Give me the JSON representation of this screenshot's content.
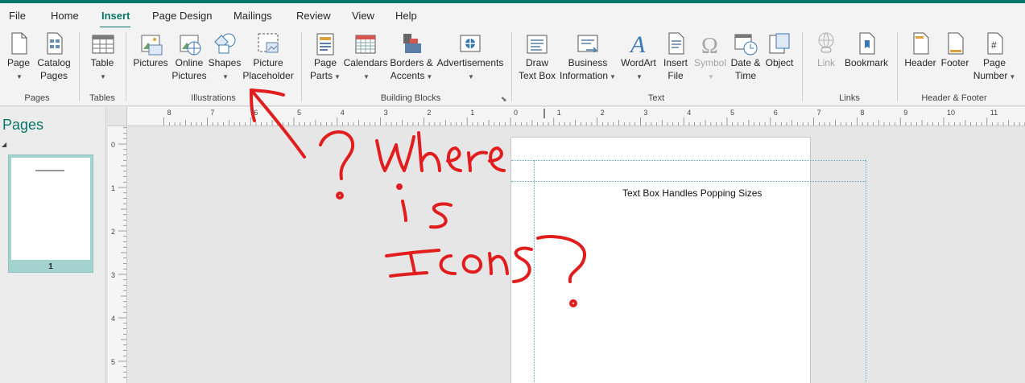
{
  "menu": {
    "tabs": [
      {
        "label": "File"
      },
      {
        "label": "Home"
      },
      {
        "label": "Insert"
      },
      {
        "label": "Page Design"
      },
      {
        "label": "Mailings"
      },
      {
        "label": "Review"
      },
      {
        "label": "View"
      },
      {
        "label": "Help"
      }
    ]
  },
  "ribbon": {
    "pages_group": {
      "label": "Pages",
      "page": "Page",
      "catalog_pages_1": "Catalog",
      "catalog_pages_2": "Pages"
    },
    "tables_group": {
      "label": "Tables",
      "table": "Table"
    },
    "illustrations_group": {
      "label": "Illustrations",
      "pictures": "Pictures",
      "online_1": "Online",
      "online_2": "Pictures",
      "shapes": "Shapes",
      "placeholder_1": "Picture",
      "placeholder_2": "Placeholder"
    },
    "building_blocks_group": {
      "label": "Building Blocks",
      "page_parts_1": "Page",
      "page_parts_2": "Parts",
      "calendars": "Calendars",
      "borders_1": "Borders &",
      "borders_2": "Accents",
      "ads": "Advertisements"
    },
    "text_group": {
      "label": "Text",
      "draw_1": "Draw",
      "draw_2": "Text Box",
      "business_1": "Business",
      "business_2": "Information",
      "wordart": "WordArt",
      "insert_file_1": "Insert",
      "insert_file_2": "File",
      "symbol": "Symbol",
      "datetime_1": "Date &",
      "datetime_2": "Time",
      "object": "Object"
    },
    "links_group": {
      "label": "Links",
      "link": "Link",
      "bookmark": "Bookmark"
    },
    "header_footer_group": {
      "label": "Header & Footer",
      "header": "Header",
      "footer": "Footer",
      "page_number_1": "Page",
      "page_number_2": "Number"
    }
  },
  "rulers": {
    "horizontal": [
      "8",
      "7",
      "6",
      "5",
      "4",
      "3",
      "2",
      "1",
      "0",
      "1",
      "2",
      "3",
      "4",
      "5",
      "6",
      "7",
      "8",
      "9",
      "10",
      "11"
    ],
    "vertical": [
      "0",
      "1",
      "2",
      "3",
      "4",
      "5"
    ]
  },
  "pages_pane": {
    "title": "Pages",
    "thumb_number": "1"
  },
  "document": {
    "text": "Text Box Handles Popping Sizes"
  },
  "colors": {
    "accent": "#077568",
    "ink": "#e11d1d"
  }
}
